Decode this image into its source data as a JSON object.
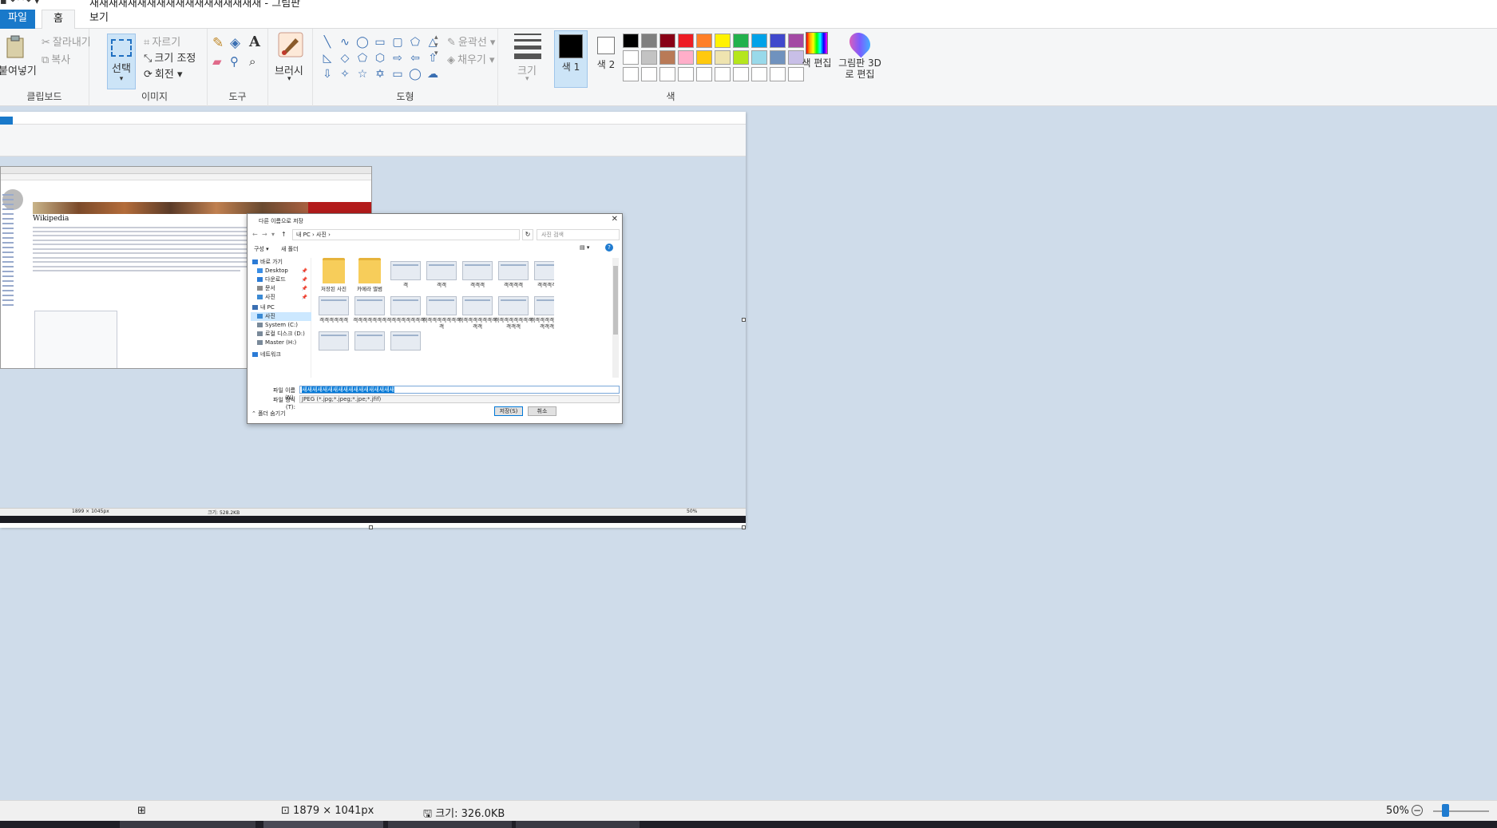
{
  "window": {
    "title": "새새새새새새새새새새새새새새새새새새 - 그림판"
  },
  "tabs": [
    {
      "label": "파일"
    },
    {
      "label": "홈"
    },
    {
      "label": "보기"
    }
  ],
  "ribbon": {
    "clipboard": {
      "label": "클립보드",
      "paste": "붙여넣기",
      "cut": "잘라내기",
      "copy": "복사"
    },
    "image": {
      "label": "이미지",
      "select": "선택",
      "crop": "자르기",
      "resize": "크기 조정",
      "rotate": "회전"
    },
    "tools": {
      "label": "도구"
    },
    "brushes": {
      "label": "브러시"
    },
    "shapes": {
      "label": "도형",
      "outline": "윤곽선",
      "fill": "채우기"
    },
    "size": {
      "label": "크기"
    },
    "colors": {
      "label": "색",
      "color1": "색 1",
      "color2": "색 2",
      "edit": "색 편집",
      "paint3d": "그림판 3D로 편집",
      "color1_value": "#000000",
      "color2_value": "#ffffff",
      "palette": [
        "#000000",
        "#7f7f7f",
        "#880015",
        "#ed1c24",
        "#ff7f27",
        "#fff200",
        "#22b14c",
        "#00a2e8",
        "#3f48cc",
        "#a349a4",
        "#ffffff",
        "#c3c3c3",
        "#b97a57",
        "#ffaec9",
        "#ffc90e",
        "#efe4b0",
        "#b5e61d",
        "#99d9ea",
        "#7092be",
        "#c8bfe7",
        "#ffffff",
        "#ffffff",
        "#ffffff",
        "#ffffff",
        "#ffffff",
        "#ffffff",
        "#ffffff",
        "#ffffff",
        "#ffffff",
        "#ffffff"
      ]
    }
  },
  "dialog": {
    "title": "다른 이름으로 저장",
    "path": "내 PC  ›  사진  ›",
    "search_placeholder": "사진 검색",
    "organize": "구성",
    "new_folder": "새 폴더",
    "nav": [
      {
        "label": "바로 가기"
      },
      {
        "label": "Desktop"
      },
      {
        "label": "다운로드"
      },
      {
        "label": "문서"
      },
      {
        "label": "사진"
      },
      {
        "label": "내 PC"
      },
      {
        "label": "사진"
      },
      {
        "label": "System (C:)"
      },
      {
        "label": "로컬 디스크 (D:)"
      },
      {
        "label": "Master (H:)"
      },
      {
        "label": "네트워크"
      }
    ],
    "files": [
      {
        "name": "저장된 사진",
        "folder": true
      },
      {
        "name": "카메라 앨범",
        "folder": true
      },
      {
        "name": "객"
      },
      {
        "name": "객객"
      },
      {
        "name": "객객객"
      },
      {
        "name": "객객객객"
      },
      {
        "name": "객객객객객"
      },
      {
        "name": "객객객객객객"
      },
      {
        "name": "객객객객객객객"
      },
      {
        "name": "객객객객객객객객"
      },
      {
        "name": "객객객객객객객객객"
      },
      {
        "name": "객객객객객객객객객객"
      },
      {
        "name": "객객객객객객객객객객객"
      },
      {
        "name": "객객객객객객객객객객객객"
      },
      {
        "name": ""
      },
      {
        "name": ""
      },
      {
        "name": ""
      }
    ],
    "filename_label": "파일 이름(N):",
    "filename_value": "새새새새새새새새새새새새새새새새새새",
    "filetype_label": "파일 형식(T):",
    "filetype_value": "JPEG (*.jpg;*.jpeg;*.jpe;*.jfif)",
    "hide_folders": "폴더 숨기기",
    "save": "저장(S)",
    "cancel": "취소"
  },
  "mini": {
    "wiki_title": "Wikipedia",
    "status_size": "1899 × 1045px",
    "status_file": "크기: 528.2KB",
    "zoom": "50%"
  },
  "statusbar": {
    "dimensions": "1879 × 1041px",
    "filesize": "크기: 326.0KB",
    "zoom": "50%",
    "zoom_level": 0.5
  }
}
